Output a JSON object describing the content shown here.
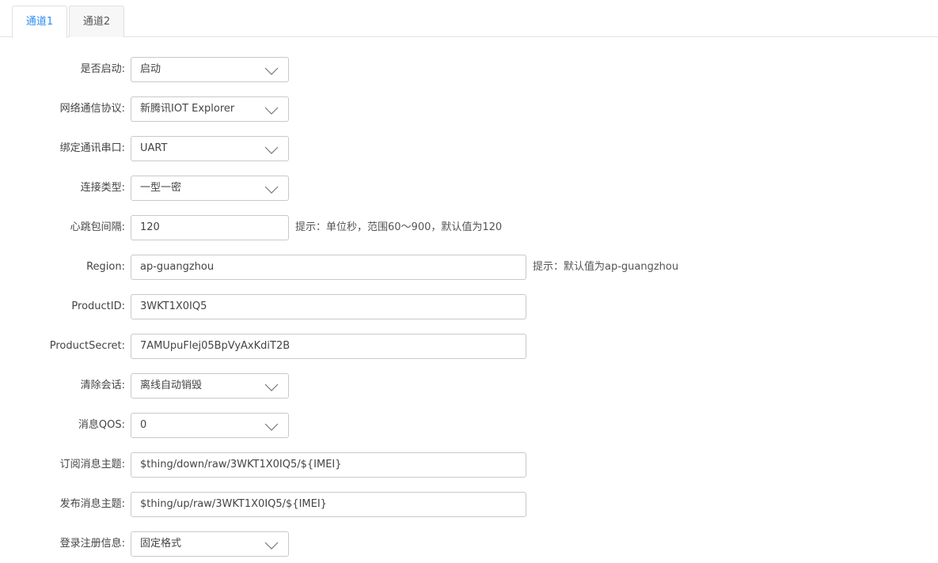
{
  "tabs": [
    {
      "label": "通道1",
      "active": true
    },
    {
      "label": "通道2",
      "active": false
    }
  ],
  "form": {
    "enabled": {
      "label": "是否启动:",
      "value": "启动"
    },
    "protocol": {
      "label": "网络通信协议:",
      "value": "新腾讯IOT Explorer"
    },
    "serial_port": {
      "label": "绑定通讯串口:",
      "value": "UART"
    },
    "connection_type": {
      "label": "连接类型:",
      "value": "一型一密"
    },
    "heartbeat": {
      "label": "心跳包间隔:",
      "value": "120",
      "hint": "提示：单位秒，范围60～900，默认值为120"
    },
    "region": {
      "label": "Region:",
      "value": "ap-guangzhou",
      "hint": "提示：默认值为ap-guangzhou"
    },
    "product_id": {
      "label": "ProductID:",
      "value": "3WKT1X0IQ5"
    },
    "product_secret": {
      "label": "ProductSecret:",
      "value": "7AMUpuFlej05BpVyAxKdiT2B"
    },
    "clean_session": {
      "label": "清除会话:",
      "value": "离线自动销毁"
    },
    "qos": {
      "label": "消息QOS:",
      "value": "0"
    },
    "subscribe_topic": {
      "label": "订阅消息主题:",
      "value": "$thing/down/raw/3WKT1X0IQ5/${IMEI}"
    },
    "publish_topic": {
      "label": "发布消息主题:",
      "value": "$thing/up/raw/3WKT1X0IQ5/${IMEI}"
    },
    "register_info": {
      "label": "登录注册信息:",
      "value": "固定格式"
    }
  },
  "colors": {
    "accent": "#2d8cf0",
    "border": "#c9c9c9",
    "text": "#444444"
  },
  "icons": {
    "dropdown": "chevron-down-icon"
  }
}
